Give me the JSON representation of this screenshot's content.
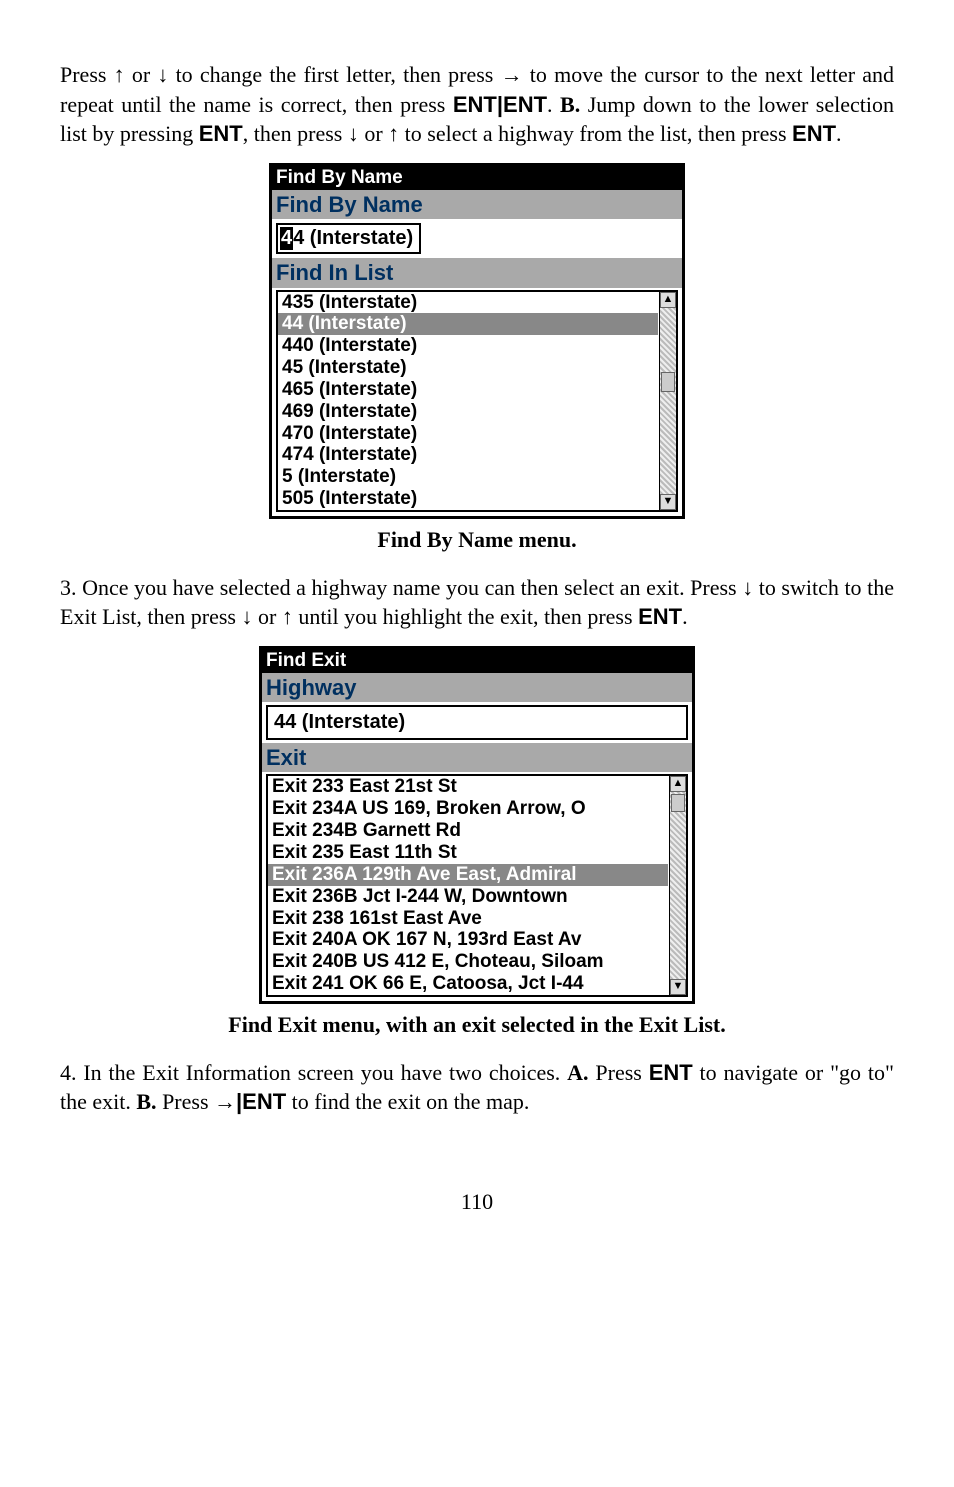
{
  "para1_a": "Press ",
  "para1_b": " or ",
  "para1_c": " to change the first letter, then press ",
  "para1_d": " to move the cursor to the next letter and repeat until the name is correct, then press ",
  "para1_ent1": "ENT",
  "para1_pipe": "|",
  "para1_ent2": "ENT",
  "para1_e": ". ",
  "para1_B": "B.",
  "para1_f": " Jump down to the lower selection list by pressing ",
  "para1_ent3": "ENT",
  "para1_g": ", then press ",
  "para1_h": " or ",
  "para1_i": " to select a highway from the list, then press ",
  "para1_ent4": "ENT",
  "para1_j": ".",
  "device1": {
    "title": "Find By Name",
    "section1": "Find By Name",
    "input_cursor": "4",
    "input_rest": "4 (Interstate)",
    "section2": "Find In List",
    "rows": [
      "435 (Interstate)",
      "44 (Interstate)",
      "440 (Interstate)",
      "45 (Interstate)",
      "465 (Interstate)",
      "469 (Interstate)",
      "470 (Interstate)",
      "474 (Interstate)",
      "5 (Interstate)",
      "505 (Interstate)"
    ],
    "selected_index": 1
  },
  "caption1": "Find By Name menu.",
  "para2_a": "3. Once you have selected a highway name you can then select an exit. Press ",
  "para2_b": " to switch to the Exit List, then press ",
  "para2_c": " or ",
  "para2_d": " until you highlight the exit, then press ",
  "para2_ent": "ENT",
  "para2_e": ".",
  "device2": {
    "title": "Find Exit",
    "section1": "Highway",
    "readonly_value": "44 (Interstate)",
    "section2": "Exit",
    "rows": [
      "Exit 233 East 21st St",
      "Exit 234A US 169, Broken Arrow, O",
      "Exit 234B Garnett Rd",
      "Exit 235 East 11th St",
      "Exit 236A 129th Ave East, Admiral",
      "Exit 236B Jct I-244 W, Downtown",
      "Exit 238 161st East Ave",
      "Exit 240A OK 167 N, 193rd East Av",
      "Exit 240B US 412 E, Choteau, Siloam",
      "Exit 241 OK 66 E, Catoosa, Jct I-44"
    ],
    "selected_index": 4
  },
  "caption2": "Find Exit menu, with an exit selected in the Exit List.",
  "para3_a": "4. In the Exit Information screen you have two choices. ",
  "para3_A": "A.",
  "para3_b": " Press ",
  "para3_ent1": "ENT",
  "para3_c": " to navigate or \"go to\" the exit. ",
  "para3_B": "B.",
  "para3_d": " Press ",
  "para3_pipe": "|",
  "para3_ent2": "ENT",
  "para3_e": " to find the exit on the map.",
  "page_number": "110",
  "arrows": {
    "up": "↑",
    "down": "↓",
    "right": "→"
  }
}
